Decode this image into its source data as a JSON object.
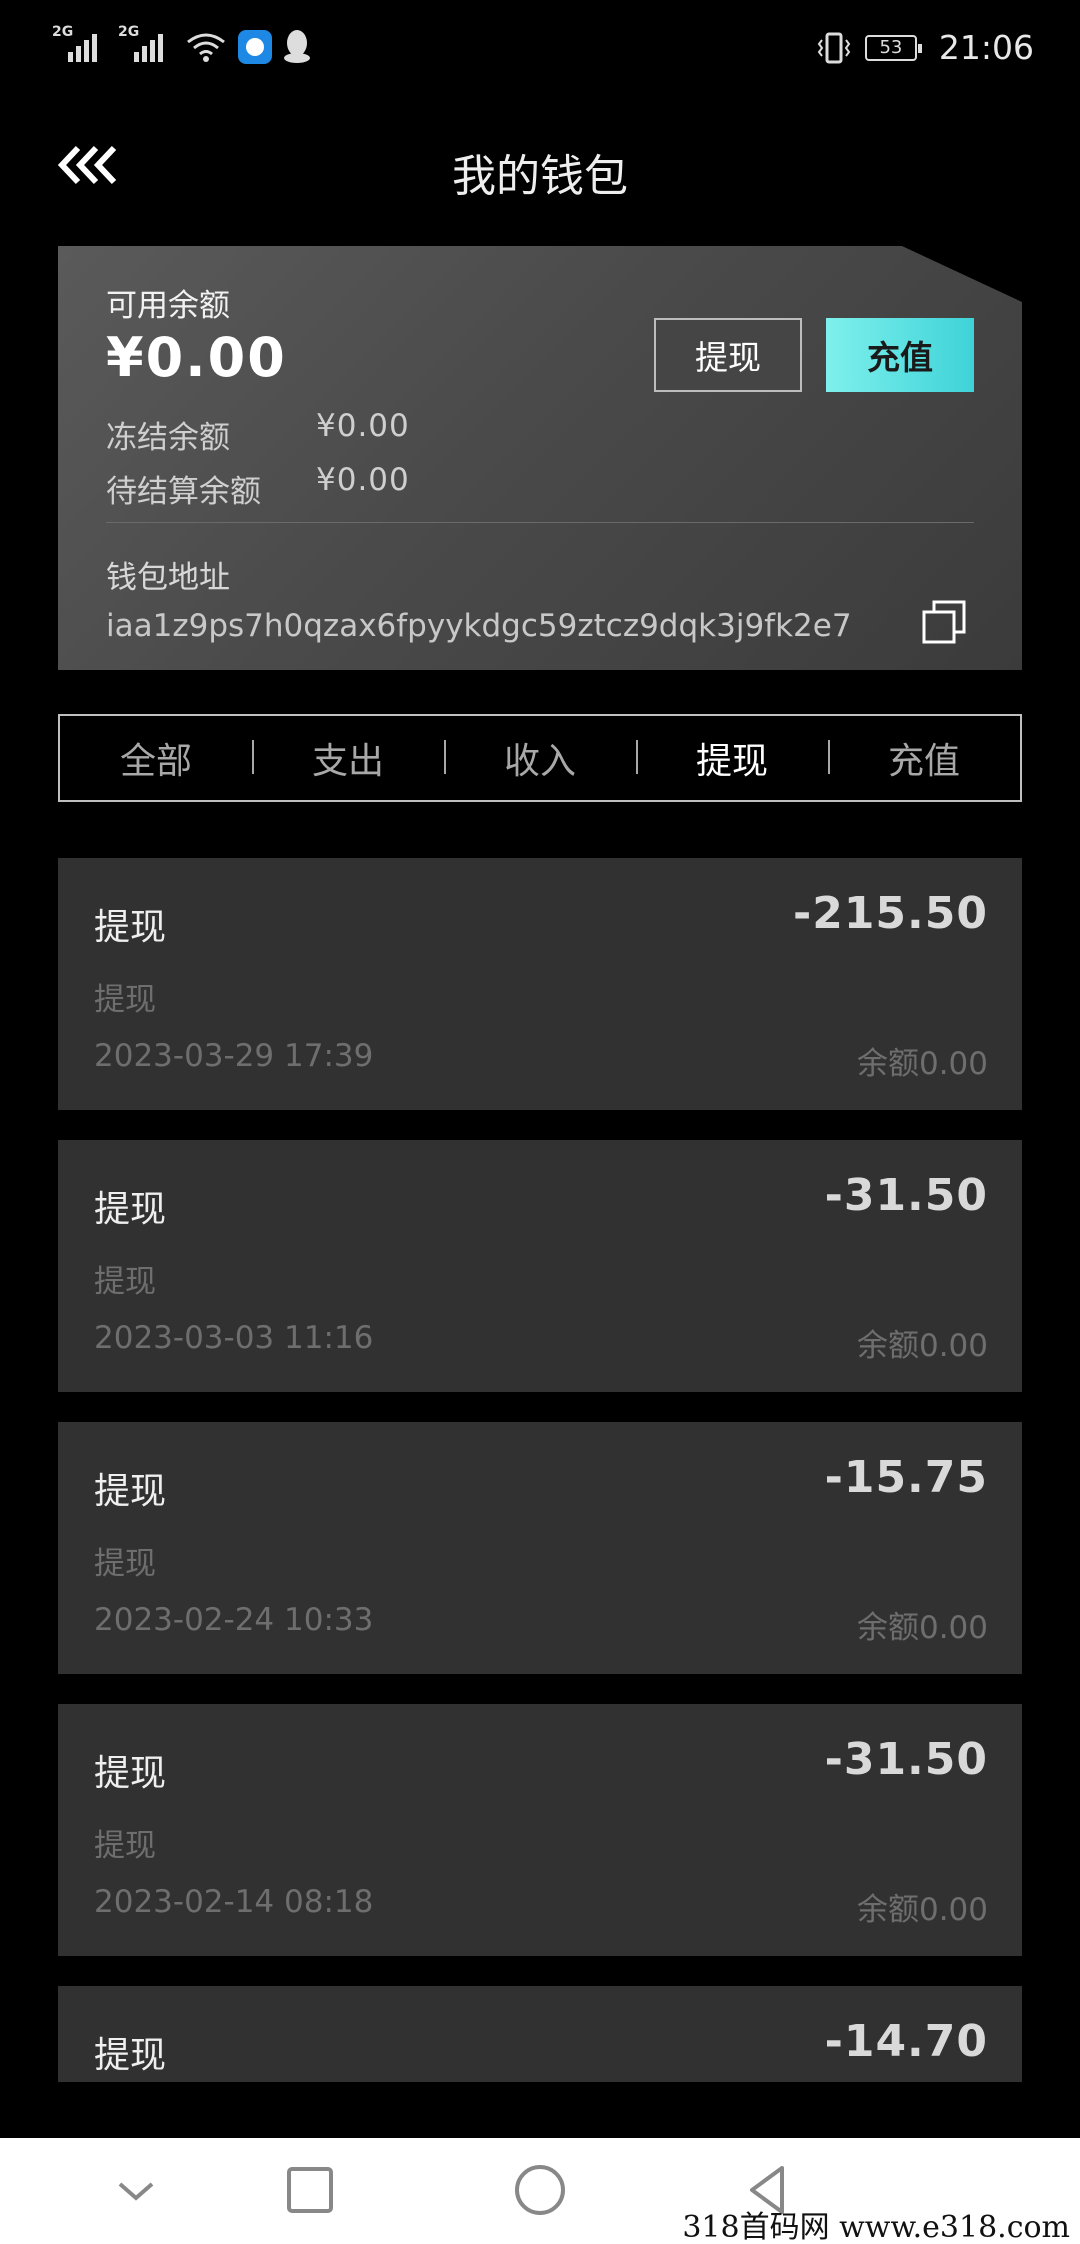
{
  "status_bar": {
    "sim1": "2G",
    "sim2": "2G",
    "battery": "53",
    "time": "21:06"
  },
  "header": {
    "title": "我的钱包"
  },
  "wallet": {
    "available_label": "可用余额",
    "available_value": "¥0.00",
    "withdraw_label": "提现",
    "recharge_label": "充值",
    "frozen_label": "冻结余额",
    "frozen_value": "¥0.00",
    "pending_label": "待结算余额",
    "pending_value": "¥0.00",
    "address_label": "钱包地址",
    "address_value": "iaa1z9ps7h0qzax6fpyykdgc59ztcz9dqk3j9fk2e7"
  },
  "tabs": [
    {
      "label": "全部"
    },
    {
      "label": "支出"
    },
    {
      "label": "收入"
    },
    {
      "label": "提现"
    },
    {
      "label": "充值"
    }
  ],
  "active_tab": "提现",
  "records": [
    {
      "title": "提现",
      "amount": "-215.50",
      "type": "提现",
      "date": "2023-03-29 17:39",
      "balance": "余额0.00"
    },
    {
      "title": "提现",
      "amount": "-31.50",
      "type": "提现",
      "date": "2023-03-03 11:16",
      "balance": "余额0.00"
    },
    {
      "title": "提现",
      "amount": "-15.75",
      "type": "提现",
      "date": "2023-02-24 10:33",
      "balance": "余额0.00"
    },
    {
      "title": "提现",
      "amount": "-31.50",
      "type": "提现",
      "date": "2023-02-14 08:18",
      "balance": "余额0.00"
    },
    {
      "title": "提现",
      "amount": "-14.70",
      "type": "",
      "date": "",
      "balance": ""
    }
  ],
  "watermark": "318首码网 www.e318.com",
  "colors": {
    "background": "#000000",
    "card": "#4a4a4a",
    "record": "#313131",
    "accent": "#3ed3d8"
  }
}
